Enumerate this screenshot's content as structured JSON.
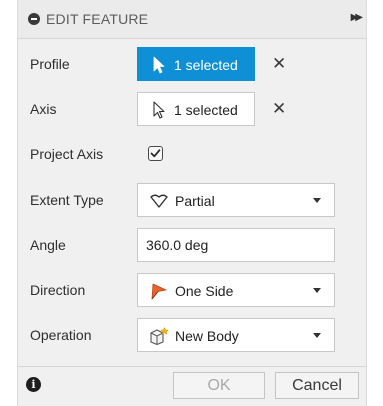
{
  "header": {
    "title": "EDIT FEATURE",
    "expand_icon": "double-chevron-right"
  },
  "fields": {
    "profile": {
      "label": "Profile",
      "value": "1 selected",
      "active": true
    },
    "axis": {
      "label": "Axis",
      "value": "1 selected",
      "active": false
    },
    "project_axis": {
      "label": "Project Axis",
      "checked": true
    },
    "extent_type": {
      "label": "Extent Type",
      "value": "Partial",
      "icon": "partial-extent-icon"
    },
    "angle": {
      "label": "Angle",
      "value": "360.0 deg"
    },
    "direction": {
      "label": "Direction",
      "value": "One Side",
      "icon": "one-side-direction-icon"
    },
    "operation": {
      "label": "Operation",
      "value": "New Body",
      "icon": "new-body-icon"
    }
  },
  "footer": {
    "ok_label": "OK",
    "cancel_label": "Cancel"
  },
  "colors": {
    "accent": "#0f8fd6",
    "direction_icon": "#e8622a",
    "new_body_star": "#f2b705"
  }
}
